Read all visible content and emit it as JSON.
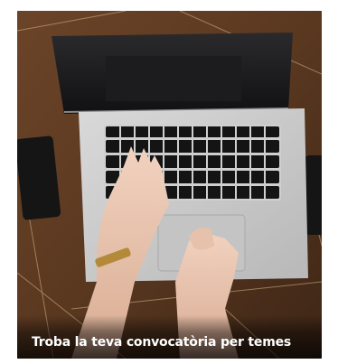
{
  "card": {
    "caption": "Troba la teva convocatòria per temes",
    "image_subject": "laptop-with-typing-hands-photo"
  }
}
